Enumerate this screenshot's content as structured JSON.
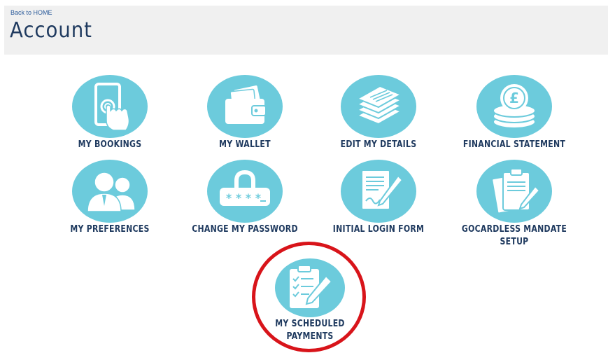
{
  "header": {
    "back_link": "Back to HOME",
    "title": "Account"
  },
  "tiles": [
    {
      "label": "MY BOOKINGS",
      "icon": "tap-phone-icon"
    },
    {
      "label": "MY WALLET",
      "icon": "wallet-icon"
    },
    {
      "label": "EDIT MY DETAILS",
      "icon": "documents-stack-icon"
    },
    {
      "label": "FINANCIAL STATEMENT",
      "icon": "pound-coins-icon"
    },
    {
      "label": "MY PREFERENCES",
      "icon": "people-icon"
    },
    {
      "label": "CHANGE MY PASSWORD",
      "icon": "padlock-password-icon"
    },
    {
      "label": "INITIAL LOGIN FORM",
      "icon": "form-pen-icon"
    },
    {
      "label": "GOCARDLESS MANDATE SETUP",
      "icon": "clipboard-pen-icon"
    },
    {
      "label": "MY SCHEDULED PAYMENTS",
      "icon": "checklist-pen-icon"
    }
  ],
  "colors": {
    "icon_bg": "#6ccbdc",
    "label": "#1f3a5f",
    "highlight": "#d8141a",
    "header_bg": "#f0f0f0"
  }
}
